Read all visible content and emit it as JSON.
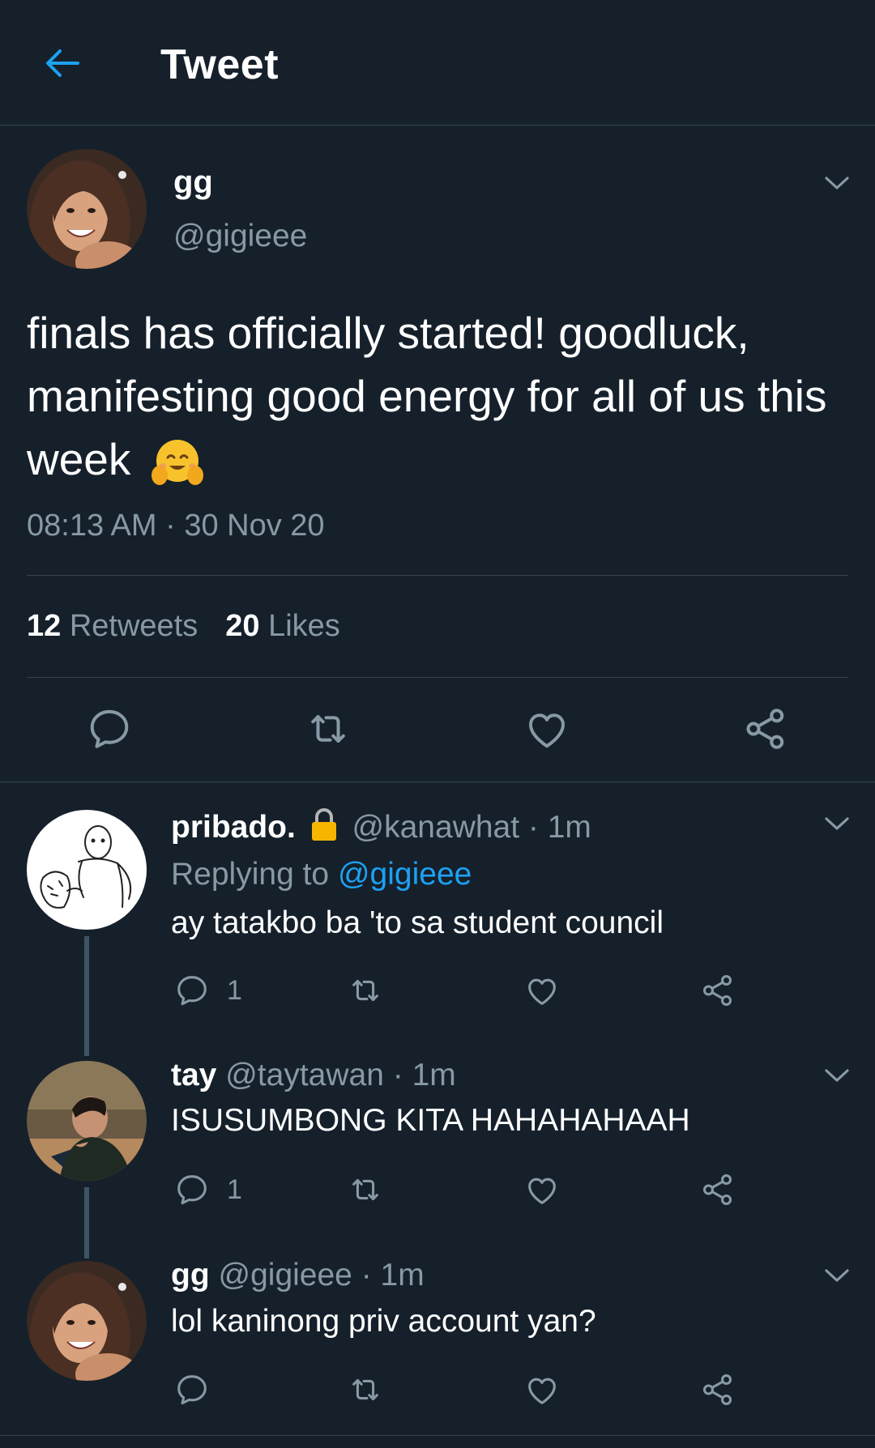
{
  "header": {
    "title": "Tweet"
  },
  "tweet": {
    "name": "gg",
    "handle": "@gigieee",
    "text": "finals has officially started! goodluck, manifesting good energy for all of us this week",
    "emoji_icon": "hugging-face-emoji",
    "timestamp": "08:13 AM · 30 Nov 20",
    "retweets": {
      "count": "12",
      "label": "Retweets"
    },
    "likes": {
      "count": "20",
      "label": "Likes"
    }
  },
  "replies": [
    {
      "name": "pribado.",
      "lock_icon": "lock-icon",
      "handle_time": "@kanawhat · 1m",
      "replying_prefix": "Replying to",
      "replying_to": "@gigieee",
      "text": "ay tatakbo ba 'to sa student council",
      "reply_count": "1"
    },
    {
      "name": "tay",
      "handle_time": "@taytawan · 1m",
      "text": "ISUSUMBONG KITA HAHAHAHAAH",
      "reply_count": "1"
    },
    {
      "name": "gg",
      "handle_time": "@gigieee · 1m",
      "text": "lol kaninong priv account yan?",
      "reply_count": ""
    }
  ],
  "colors": {
    "background": "#15202b",
    "accent": "#1da1f2",
    "muted": "#8899a6",
    "divider": "#38444d"
  }
}
